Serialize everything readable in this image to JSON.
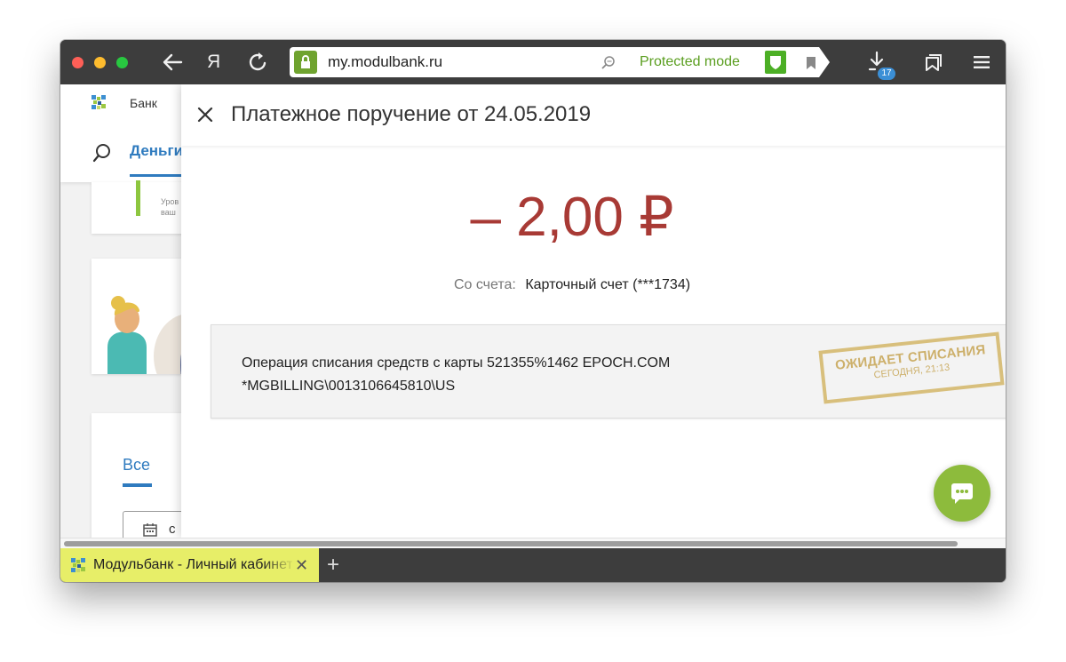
{
  "browser": {
    "url": "my.modulbank.ru",
    "protected_mode_label": "Protected mode",
    "downloads_count": "17",
    "yandex_glyph": "Я",
    "accent_green": "#4caf25"
  },
  "background_page": {
    "bank_label": "Банк",
    "nav_active": "Деньги",
    "card_hint": "Уров\nваш",
    "filter_tab": "Все",
    "date_prefix": "с"
  },
  "drawer": {
    "title": "Платежное поручение от 24.05.2019",
    "amount": "– 2,00 ₽",
    "amount_color": "#a83a35",
    "from_label": "Со счета:",
    "from_value": "Карточный счет (***1734)",
    "operation_line1": "Операция списания средств с карты 521355%1462 EPOCH.COM",
    "operation_line2": "*MGBILLING\\0013106645810\\US",
    "stamp_status": "ОЖИДАЕТ СПИСАНИЯ",
    "stamp_time": "СЕГОДНЯ, 21:13"
  },
  "tabs": [
    {
      "title": "Модульбанк - Личный кабинет",
      "close_glyph": "✕"
    }
  ],
  "new_tab_glyph": "+"
}
